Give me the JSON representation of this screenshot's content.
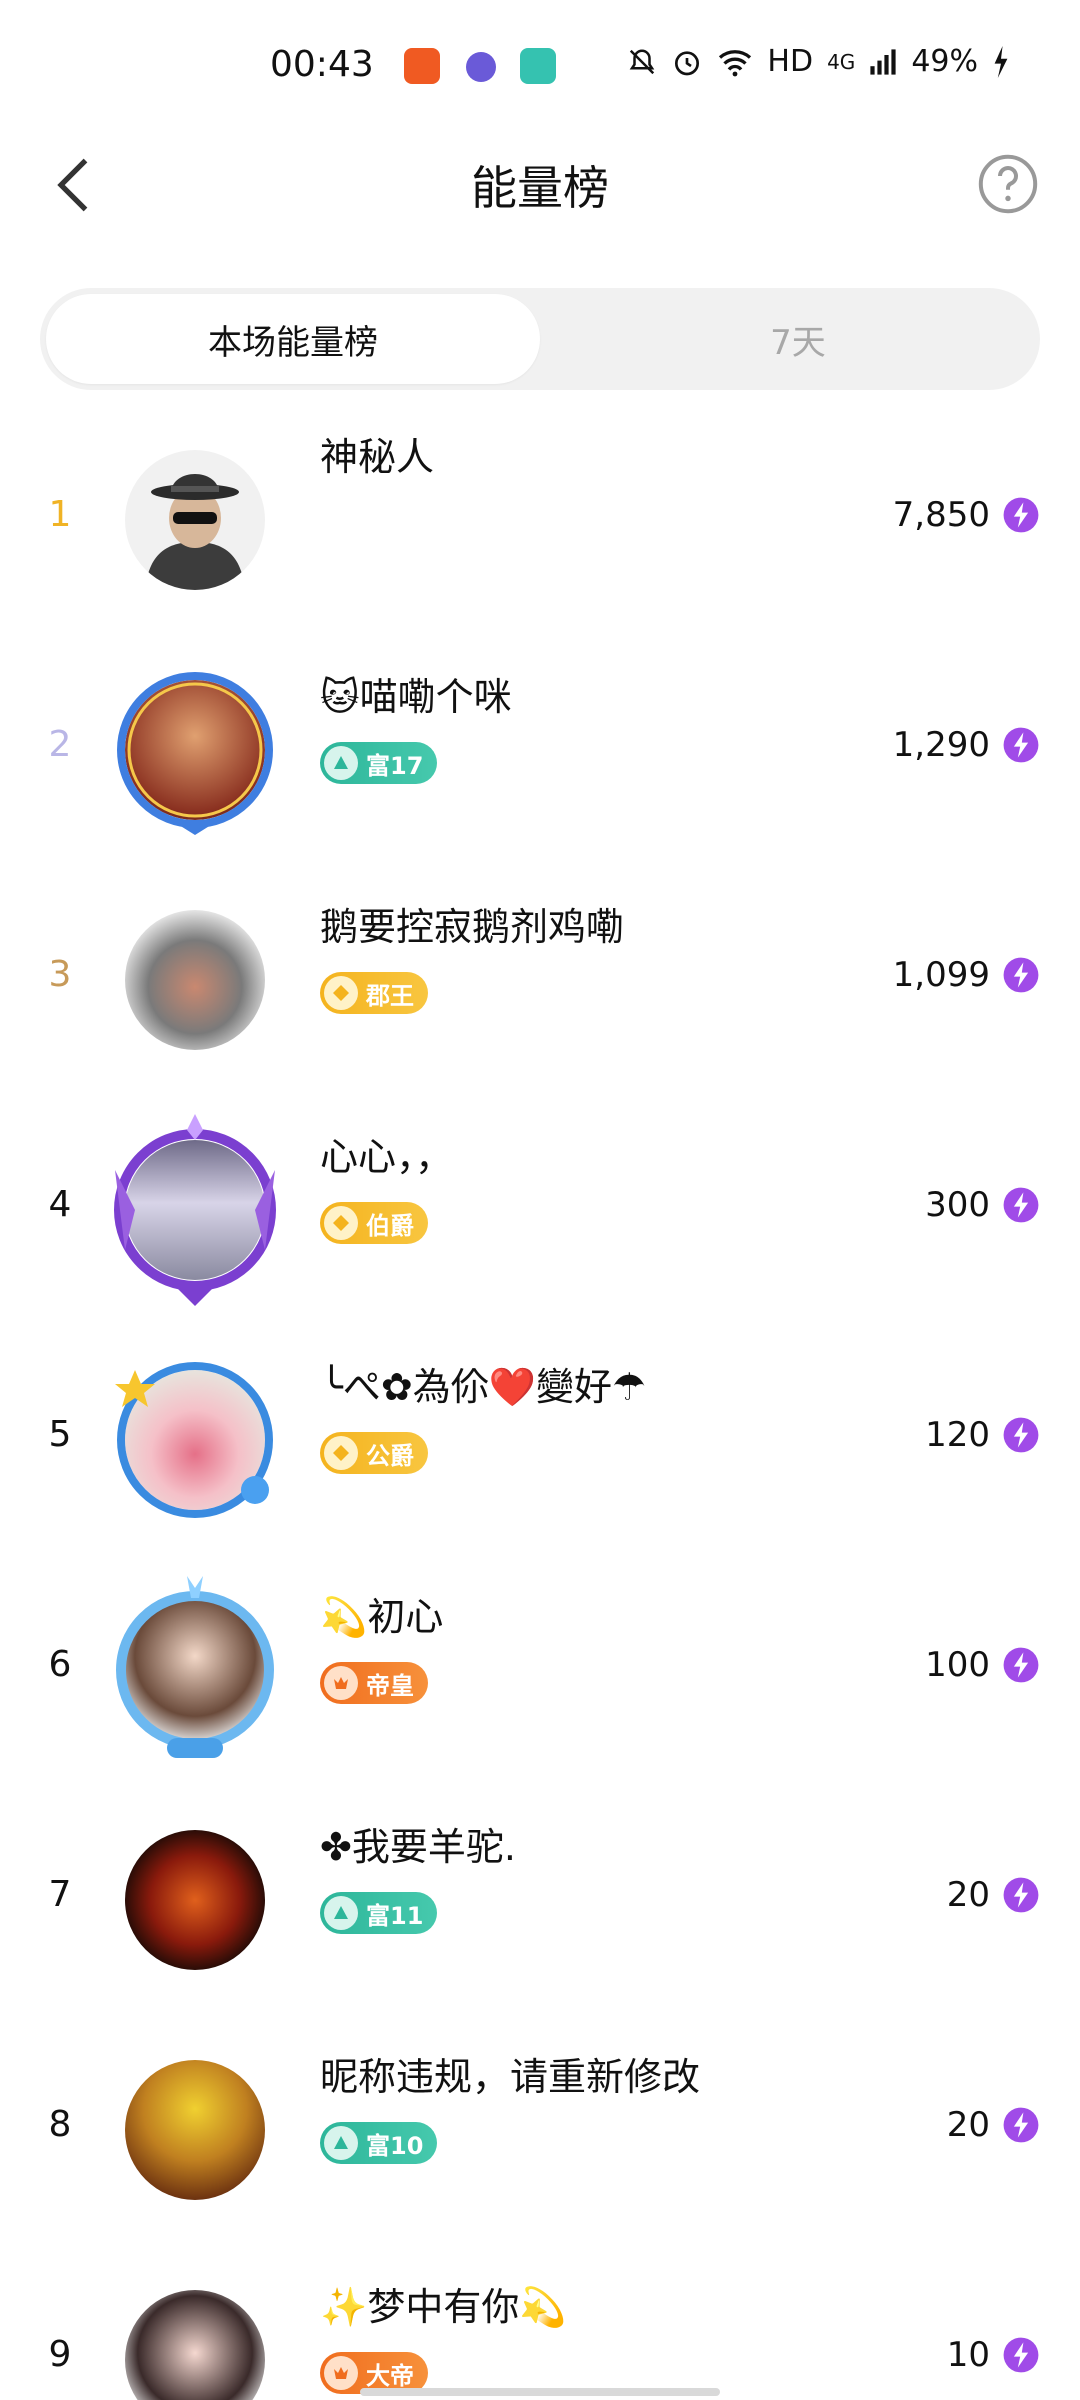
{
  "status_bar": {
    "time": "00:43",
    "network": "HD",
    "signal": "4G",
    "battery": "49%"
  },
  "header": {
    "title": "能量榜",
    "back_icon": "chevron-left-icon",
    "help_icon": "question-circle-icon"
  },
  "tabs": [
    {
      "label": "本场能量榜",
      "active": true
    },
    {
      "label": "7天",
      "active": false
    }
  ],
  "ranking": [
    {
      "rank": "1",
      "name": "神秘人",
      "badge": "",
      "badge_color": "",
      "score": "7,850"
    },
    {
      "rank": "2",
      "name": "🐱喵嘞个咪",
      "badge": "富17",
      "badge_color": "teal",
      "score": "1,290"
    },
    {
      "rank": "3",
      "name": "鹅要控寂鹅剂鸡嘞",
      "badge": "郡王",
      "badge_color": "gold",
      "score": "1,099"
    },
    {
      "rank": "4",
      "name": "心心，，",
      "badge": "伯爵",
      "badge_color": "gold",
      "score": "300"
    },
    {
      "rank": "5",
      "name": "╰ぺ✿為伱❤️變好☂",
      "badge": "公爵",
      "badge_color": "gold",
      "score": "120"
    },
    {
      "rank": "6",
      "name": "💫初心",
      "badge": "帝皇",
      "badge_color": "orange",
      "score": "100"
    },
    {
      "rank": "7",
      "name": "✤我要羊驼.",
      "badge": "富11",
      "badge_color": "teal",
      "score": "20"
    },
    {
      "rank": "8",
      "name": "昵称违规，请重新修改",
      "badge": "富10",
      "badge_color": "teal",
      "score": "20"
    },
    {
      "rank": "9",
      "name": "✨梦中有你💫",
      "badge": "大帝",
      "badge_color": "orange",
      "score": "10"
    }
  ],
  "colors": {
    "rank1": "#f0b325",
    "rank2": "#b9b6e6",
    "rank3": "#c79a59",
    "energy_icon": "#a04be8"
  }
}
